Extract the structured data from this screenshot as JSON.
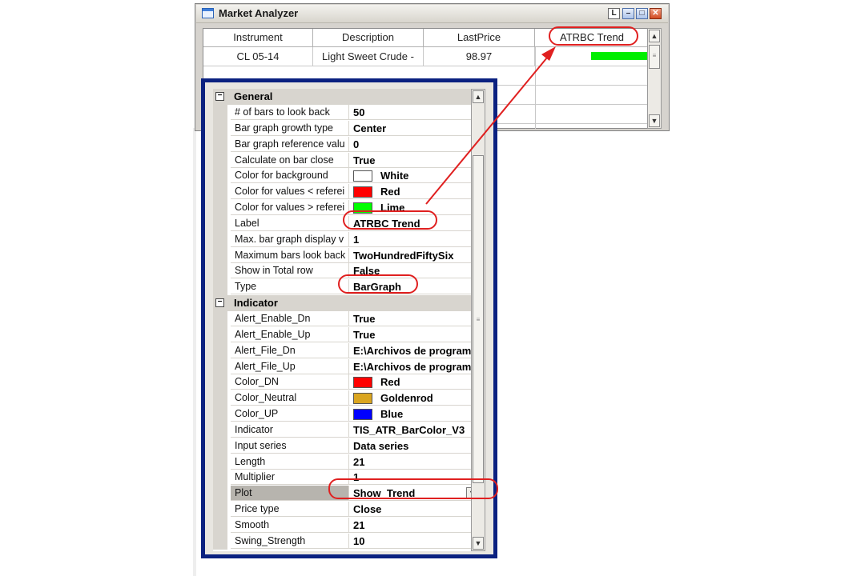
{
  "window": {
    "title": "Market Analyzer",
    "buttons": {
      "layout": "L",
      "minimize": "–",
      "maximize": "□",
      "close": "✕"
    }
  },
  "grid": {
    "columns": [
      "Instrument",
      "Description",
      "LastPrice",
      "ATRBC Trend"
    ],
    "rows": [
      {
        "instrument": "CL 05-14",
        "description": "Light Sweet Crude -",
        "last_price": "98.97",
        "trend_color": "#00ee00"
      }
    ]
  },
  "properties": {
    "categories": [
      {
        "name": "General",
        "toggle": "⊟",
        "items": [
          {
            "name": "# of bars to look back",
            "value": "50"
          },
          {
            "name": "Bar graph growth type",
            "value": "Center"
          },
          {
            "name": "Bar graph reference valu",
            "value": "0"
          },
          {
            "name": "Calculate on bar close",
            "value": "True"
          },
          {
            "name": "Color for background",
            "value": "White",
            "swatch": "#ffffff"
          },
          {
            "name": "Color for values < referei",
            "value": "Red",
            "swatch": "#ff0000"
          },
          {
            "name": "Color for values > referei",
            "value": "Lime",
            "swatch": "#00ff00"
          },
          {
            "name": "Label",
            "value": "ATRBC Trend"
          },
          {
            "name": "Max. bar graph display v",
            "value": "1"
          },
          {
            "name": "Maximum bars look back",
            "value": "TwoHundredFiftySix"
          },
          {
            "name": "Show in Total row",
            "value": "False"
          },
          {
            "name": "Type",
            "value": "BarGraph"
          }
        ]
      },
      {
        "name": "Indicator",
        "toggle": "⊟",
        "items": [
          {
            "name": "Alert_Enable_Dn",
            "value": "True"
          },
          {
            "name": "Alert_Enable_Up",
            "value": "True"
          },
          {
            "name": "Alert_File_Dn",
            "value": "E:\\Archivos de program"
          },
          {
            "name": "Alert_File_Up",
            "value": "E:\\Archivos de program"
          },
          {
            "name": "Color_DN",
            "value": "Red",
            "swatch": "#ff0000"
          },
          {
            "name": "Color_Neutral",
            "value": "Goldenrod",
            "swatch": "#daa520"
          },
          {
            "name": "Color_UP",
            "value": "Blue",
            "swatch": "#0000ff"
          },
          {
            "name": "Indicator",
            "value": "TIS_ATR_BarColor_V3"
          },
          {
            "name": "Input series",
            "value": "Data series"
          },
          {
            "name": "Length",
            "value": "21"
          },
          {
            "name": "Multiplier",
            "value": "1"
          },
          {
            "name": "Plot",
            "value": "Show_Trend",
            "dropdown": true,
            "selected": true
          },
          {
            "name": "Price type",
            "value": "Close"
          },
          {
            "name": "Smooth",
            "value": "21"
          },
          {
            "name": "Swing_Strength",
            "value": "10"
          }
        ]
      }
    ]
  },
  "colors": {
    "annotation": "#e02020",
    "panel_border": "#0b2180"
  }
}
